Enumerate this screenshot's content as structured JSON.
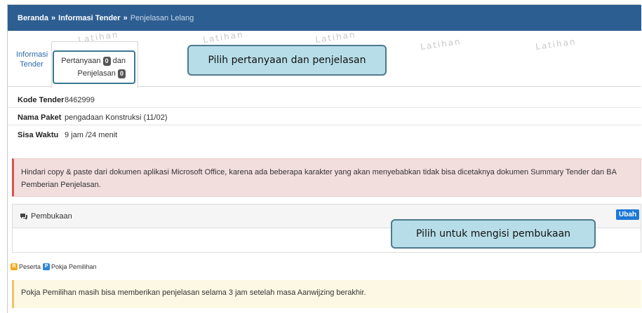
{
  "breadcrumb": {
    "home": "Beranda",
    "sep1": "»",
    "info": "Informasi Tender",
    "sep2": "»",
    "current": "Penjelasan Lelang"
  },
  "watermark": "Latihan",
  "tabs": {
    "info_line1": "Informasi",
    "info_line2": "Tender",
    "qa_pertanyaan": "Pertanyaan",
    "qa_pertanyaan_count": "0",
    "qa_dan": "dan",
    "qa_penjelasan": "Penjelasan",
    "qa_penjelasan_count": "0"
  },
  "callouts": {
    "tab": "Pilih pertanyaan dan penjelasan",
    "pembukaan": "Pilih untuk mengisi pembukaan"
  },
  "details": {
    "kode_label": "Kode Tender",
    "kode_value": "8462999",
    "nama_label": "Nama Paket",
    "nama_value": "pengadaan Konstruksi (11/02)",
    "sisa_label": "Sisa Waktu",
    "sisa_value": "9 jam /24 menit"
  },
  "alert_danger": "Hindari copy & paste dari dokumen aplikasi Microsoft Office, karena ada beberapa karakter yang akan menyebabkan tidak bisa dicetaknya dokumen Summary Tender dan BA Pemberian Penjelasan.",
  "panel": {
    "title": "Pembukaan",
    "button": "Ubah"
  },
  "legend": {
    "r_letter": "R",
    "r_label": "Peserta",
    "p_letter": "P",
    "p_label": "Pokja Pemilihan"
  },
  "alert_warning": "Pokja Pemilihan masih bisa memberikan penjelasan selama 3 jam setelah masa Aanwijzing berakhir.",
  "colors": {
    "header": "#2d5e92",
    "callout": "#b7dde8",
    "button": "#1d78d6"
  }
}
